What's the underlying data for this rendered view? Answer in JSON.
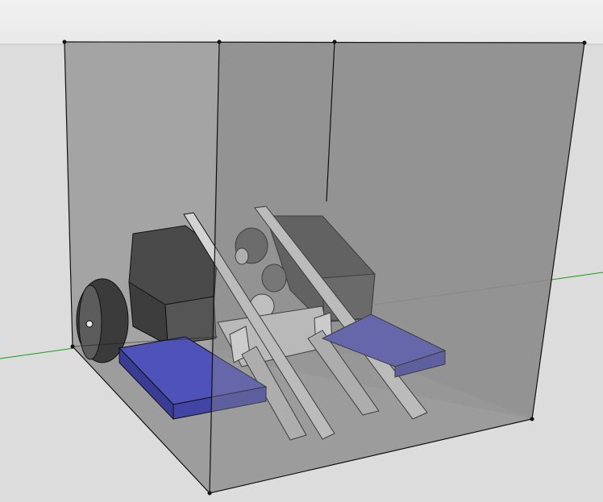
{
  "viewport": {
    "colors": {
      "sky_top": "#f1f1f1",
      "sky_bottom": "#e9e9e9",
      "ground": "#dcdcdc",
      "axis_green": "#1a9a1a",
      "box_edge": "#111111",
      "box_back": "#8a8a8a",
      "box_left": "#9a9a9a",
      "box_floor": "#9c9c9c",
      "box_right": "#8e8e8e",
      "motor_dark": "#4a4a4a",
      "motor_mid": "#5b5b5b",
      "frame_light": "#d0d0d0",
      "wheel_blue": "#4f52b8",
      "wheel_blue_side": "#3a3d95"
    },
    "model": {
      "name_icon": "robot-chassis-model"
    }
  }
}
